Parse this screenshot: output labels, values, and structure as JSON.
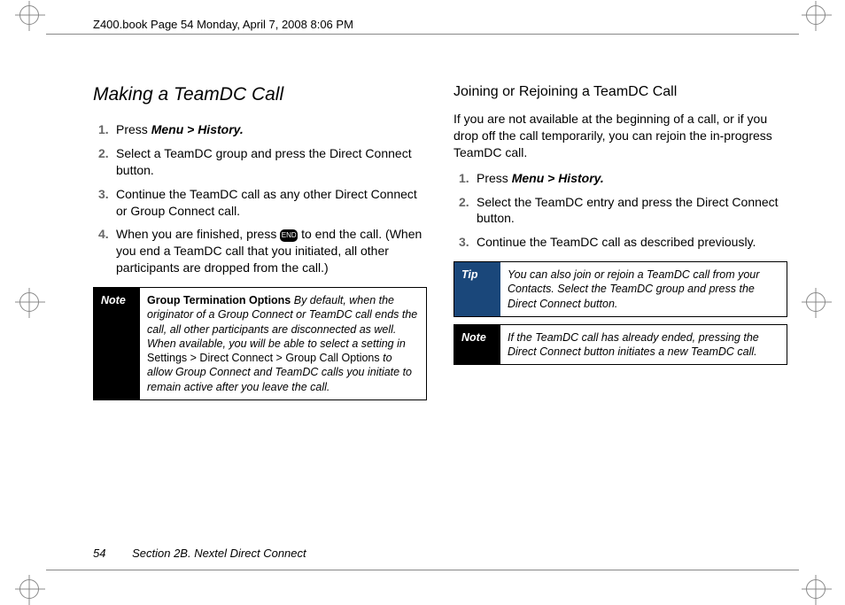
{
  "header": {
    "running_head": "Z400.book  Page 54  Monday, April 7, 2008  8:06 PM"
  },
  "left": {
    "heading": "Making a TeamDC Call",
    "steps": [
      {
        "num": "1.",
        "pre": "Press ",
        "menu": "Menu > History."
      },
      {
        "num": "2.",
        "text": "Select a TeamDC group and press the Direct Connect button."
      },
      {
        "num": "3.",
        "text": "Continue the TeamDC call as any other Direct Connect or Group Connect call."
      },
      {
        "num": "4.",
        "pre": "When you are finished, press ",
        "post": " to end the call. (When you end a TeamDC call that you initiated, all other participants are dropped from the call.)"
      }
    ],
    "note": {
      "label": "Note",
      "lead": "Group Termination Options",
      "body1": " By default, when the originator of a Group Connect or TeamDC call ends the call, all other participants are disconnected as well. When available, you will be able to select a setting in ",
      "path": "Settings > Direct Connect > Group Call Options",
      "body2": " to allow Group Connect and TeamDC calls you initiate to remain active after you leave the call."
    }
  },
  "right": {
    "heading": "Joining or Rejoining a TeamDC Call",
    "intro": "If you are not available at the beginning of a call, or if you drop off the call temporarily, you can rejoin the in-progress TeamDC call.",
    "steps": [
      {
        "num": "1.",
        "pre": "Press ",
        "menu": "Menu > History."
      },
      {
        "num": "2.",
        "text": "Select the TeamDC entry and press the Direct Connect button."
      },
      {
        "num": "3.",
        "text": "Continue the TeamDC call as described previously."
      }
    ],
    "tip": {
      "label": "Tip",
      "text": "You can also join or rejoin a TeamDC call from your Contacts. Select the TeamDC group and press the Direct Connect button."
    },
    "note": {
      "label": "Note",
      "text": "If the TeamDC call has already ended, pressing the Direct Connect button initiates a new TeamDC call."
    }
  },
  "footer": {
    "page": "54",
    "section": "Section 2B. Nextel Direct Connect"
  },
  "icons": {
    "end_call": "END"
  }
}
